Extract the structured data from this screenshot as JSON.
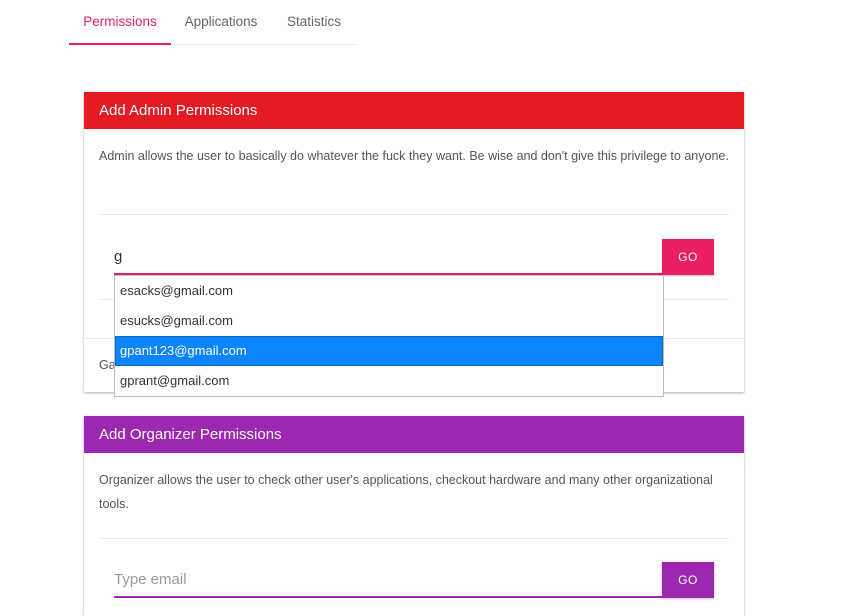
{
  "tabs": [
    {
      "label": "Permissions"
    },
    {
      "label": "Applications"
    },
    {
      "label": "Statistics"
    }
  ],
  "colors": {
    "accent": "#e91e63",
    "admin_header": "#e41b22",
    "organizer_header": "#9c27b0",
    "dropdown_selected": "#0a84ff"
  },
  "admin_card": {
    "title": "Add Admin Permissions",
    "description": "Admin allows the user to basically do whatever the fuck they want. Be wise and don't give this privilege to anyone.",
    "input_value": "g",
    "input_placeholder": "Type email",
    "go_label": "GO",
    "footer_text_partial": "Ga"
  },
  "autocomplete": {
    "items": [
      "esacks@gmail.com",
      "esucks@gmail.com",
      "gpant123@gmail.com",
      "gprant@gmail.com"
    ],
    "selected_index": 2
  },
  "organizer_card": {
    "title": "Add Organizer Permissions",
    "description": "Organizer allows the user to check other user's applications, checkout hardware and many other organizational tools.",
    "input_value": "",
    "input_placeholder": "Type email",
    "go_label": "GO"
  }
}
